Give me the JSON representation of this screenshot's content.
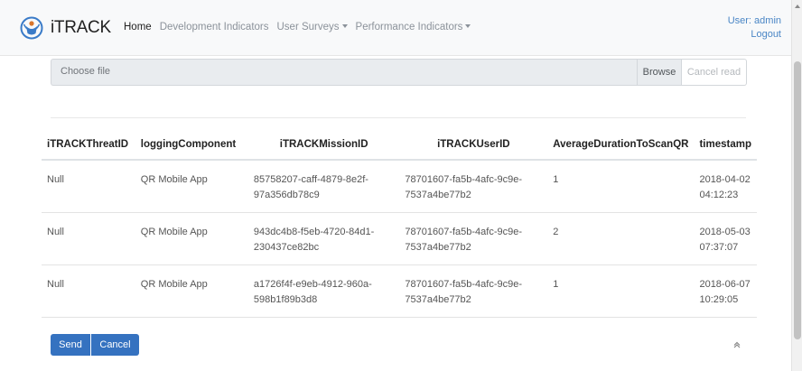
{
  "app": {
    "brand": "iTRACK"
  },
  "nav": [
    {
      "label": "Home",
      "active": true,
      "dropdown": false
    },
    {
      "label": "Development Indicators",
      "active": false,
      "dropdown": false
    },
    {
      "label": "User Surveys",
      "active": false,
      "dropdown": true
    },
    {
      "label": "Performance Indicators",
      "active": false,
      "dropdown": true
    }
  ],
  "user": {
    "label": "User: admin",
    "logout": "Logout"
  },
  "file": {
    "placeholder": "Choose file",
    "browse": "Browse",
    "cancel_read": "Cancel read"
  },
  "table": {
    "headers": [
      "iTRACKThreatID",
      "loggingComponent",
      "iTRACKMissionID",
      "iTRACKUserID",
      "AverageDurationToScanQR",
      "timestamp"
    ],
    "rows": [
      [
        "Null",
        "QR Mobile App",
        "85758207-caff-4879-8e2f-97a356db78c9",
        "78701607-fa5b-4afc-9c9e-7537a4be77b2",
        "1",
        "2018-04-02 04:12:23"
      ],
      [
        "Null",
        "QR Mobile App",
        "943dc4b8-f5eb-4720-84d1-230437ce82bc",
        "78701607-fa5b-4afc-9c9e-7537a4be77b2",
        "2",
        "2018-05-03 07:37:07"
      ],
      [
        "Null",
        "QR Mobile App",
        "a1726f4f-e9eb-4912-960a-598b1f89b3d8",
        "78701607-fa5b-4afc-9c9e-7537a4be77b2",
        "1",
        "2018-06-07 10:29:05"
      ]
    ]
  },
  "actions": {
    "send": "Send",
    "cancel": "Cancel"
  },
  "icons": {
    "logo": "itrack-logo-icon",
    "to_top": "chevron-up-icon"
  },
  "colors": {
    "primary": "#3572c0",
    "link": "#4a86c5",
    "nav_muted": "#8b929a"
  }
}
